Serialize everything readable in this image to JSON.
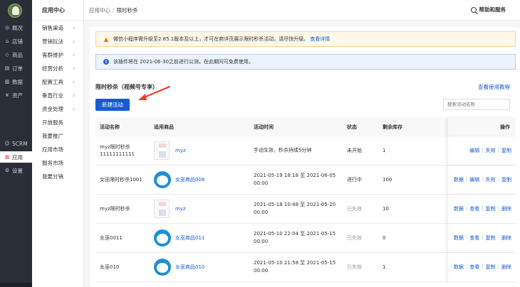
{
  "nav": {
    "items": [
      {
        "label": "概况",
        "icon": "overview-icon"
      },
      {
        "label": "店铺",
        "icon": "store-icon"
      },
      {
        "label": "商品",
        "icon": "tag-icon"
      },
      {
        "label": "订单",
        "icon": "order-icon"
      },
      {
        "label": "数据",
        "icon": "chart-icon"
      },
      {
        "label": "资产",
        "icon": "asset-icon"
      }
    ],
    "bottom": [
      {
        "label": "SCRM",
        "icon": "user-icon"
      },
      {
        "label": "应用",
        "icon": "apps-icon"
      },
      {
        "label": "设置",
        "icon": "gear-icon"
      }
    ]
  },
  "sidebar": {
    "title": "应用中心",
    "items": [
      {
        "label": "销售渠道",
        "chevron": true
      },
      {
        "label": "营销玩法",
        "chevron": true
      },
      {
        "label": "客群维护",
        "chevron": true
      },
      {
        "label": "经营分析",
        "chevron": true
      },
      {
        "label": "配置工具",
        "chevron": true
      },
      {
        "label": "垂直行业",
        "chevron": true
      },
      {
        "label": "资金处理",
        "chevron": true
      },
      {
        "label": "开放服务",
        "chevron": false
      },
      {
        "label": "我要推广",
        "chevron": false
      },
      {
        "label": "应用市场",
        "chevron": false
      },
      {
        "label": "服务市场",
        "chevron": false
      },
      {
        "label": "我要分销",
        "chevron": false
      }
    ]
  },
  "header": {
    "crumb_root": "应用中心",
    "crumb_sep": "/",
    "crumb_current": "限时秒杀",
    "help": "帮助和服务"
  },
  "alerts": {
    "warn_text": "微信小程序需升级至2.85.1版本及以上，才可在商详页展示限时秒杀活动，请尽快升级。",
    "warn_link": "查看详情",
    "info_text": "该插件将在 2021-06-30之前进行公测，在此期间可免费使用。"
  },
  "section": {
    "title": "限时秒杀（视频号专享）",
    "guide": "查看使用教程",
    "new_button": "新建活动",
    "search_placeholder": "搜索活动名称"
  },
  "table": {
    "headers": [
      "活动名称",
      "适用商品",
      "活动时间",
      "状态",
      "剩余库存",
      "操作"
    ],
    "rows": [
      {
        "name": "myz限时秒杀\n11111111111",
        "thumb": "phone",
        "product": "myz",
        "time": "手动生效，秒杀持续5分钟",
        "status": "未开始",
        "dim": false,
        "stock": "1",
        "ops": [
          "编辑",
          "失效",
          "复制"
        ]
      },
      {
        "name": "女巫限时秒杀1001",
        "thumb": "dora",
        "product": "女巫商品008",
        "time": "2021-05-19 18:18 至 2021-06-05 00:00",
        "status": "进行中",
        "dim": false,
        "stock": "100",
        "ops": [
          "数据",
          "编辑",
          "失效",
          "复制"
        ]
      },
      {
        "name": "myz限时秒杀",
        "thumb": "phone",
        "product": "myz",
        "time": "2021-05-18 10:48 至 2021-05-20 00:00",
        "status": "已失效",
        "dim": true,
        "stock": "10",
        "ops": [
          "数据",
          "查看",
          "复制",
          "删除"
        ]
      },
      {
        "name": "女巫0011",
        "thumb": "dora",
        "product": "女巫商品011",
        "time": "2021-05-10 22:04 至 2021-05-15 00:00",
        "status": "已失效",
        "dim": true,
        "stock": "0",
        "ops": [
          "数据",
          "查看",
          "复制",
          "删除"
        ]
      },
      {
        "name": "女巫010",
        "thumb": "dora",
        "product": "女巫商品010",
        "time": "2021-05-10 21:58 至 2021-05-15 00:00",
        "status": "已失效",
        "dim": true,
        "stock": "1",
        "ops": [
          "数据",
          "查看",
          "复制",
          "删除"
        ]
      }
    ]
  },
  "colors": {
    "primary": "#155bd4",
    "annotation_arrow": "#e8412c"
  }
}
